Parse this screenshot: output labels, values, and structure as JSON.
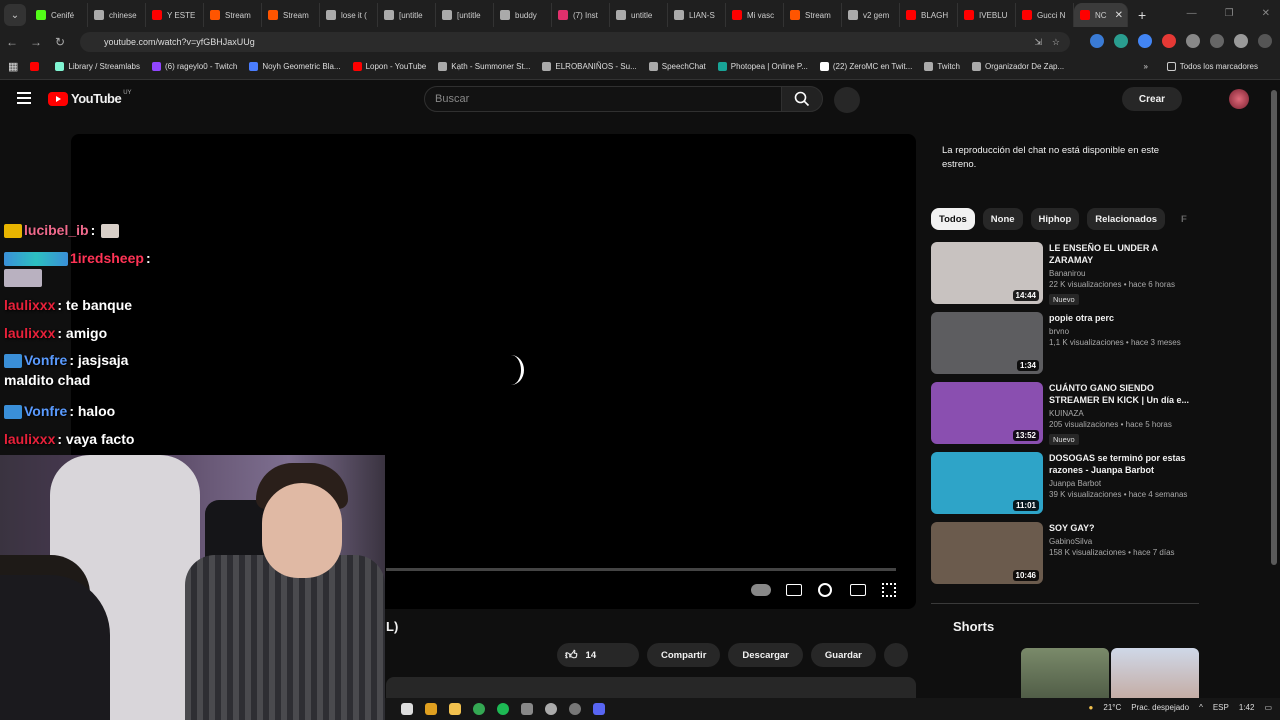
{
  "browser": {
    "tabs": [
      {
        "label": "Cenifé",
        "color": "#53fc18"
      },
      {
        "label": "chinese",
        "color": "#aaaaaa"
      },
      {
        "label": "Y ESTE",
        "color": "#ff0000"
      },
      {
        "label": "Stream",
        "color": "#ff5500"
      },
      {
        "label": "Stream",
        "color": "#ff5500"
      },
      {
        "label": "lose it (",
        "color": "#aaaaaa"
      },
      {
        "label": "[untitle",
        "color": "#aaaaaa"
      },
      {
        "label": "[untitle",
        "color": "#aaaaaa"
      },
      {
        "label": "buddy",
        "color": "#aaaaaa"
      },
      {
        "label": "(7) Inst",
        "color": "#e1306c"
      },
      {
        "label": "untitle",
        "color": "#aaaaaa"
      },
      {
        "label": "LIAN-S",
        "color": "#aaaaaa"
      },
      {
        "label": "Mi vasc",
        "color": "#ff0000"
      },
      {
        "label": "Stream",
        "color": "#ff5500"
      },
      {
        "label": "v2 gem",
        "color": "#aaaaaa"
      },
      {
        "label": "BLAGH",
        "color": "#ff0000"
      },
      {
        "label": "IVEBLU",
        "color": "#ff0000"
      },
      {
        "label": "Gucci N",
        "color": "#ff0000"
      },
      {
        "label": "NC",
        "color": "#ff0000"
      }
    ],
    "url": "youtube.com/watch?v=yfGBHJaxUUg",
    "bookmarks": [
      {
        "label": "",
        "color": "#ff0000"
      },
      {
        "label": "Library / Streamlabs",
        "color": "#80f5d2"
      },
      {
        "label": "(6) rageylo0 - Twitch",
        "color": "#9146ff"
      },
      {
        "label": "Noyh Geometric Bla...",
        "color": "#4a7dff"
      },
      {
        "label": "Lopon - YouTube",
        "color": "#ff0000"
      },
      {
        "label": "Kạth - Summoner St...",
        "color": "#aaaaaa"
      },
      {
        "label": "ELROBANIÑOS - Su...",
        "color": "#aaaaaa"
      },
      {
        "label": "SpeechChat",
        "color": "#aaaaaa"
      },
      {
        "label": "Photopea | Online P...",
        "color": "#18a497"
      },
      {
        "label": "(22) ZeroMC en Twit...",
        "color": "#ffffff"
      },
      {
        "label": "Twitch",
        "color": "#aaaaaa"
      },
      {
        "label": "Organizador De Zap...",
        "color": "#aaaaaa"
      }
    ],
    "all_bookmarks": "Todos los marcadores"
  },
  "youtube": {
    "logo_text": "YouTube",
    "region": "UY",
    "search_placeholder": "Buscar",
    "create_label": "Crear",
    "chat_notice": "La reproducción del chat no está disponible en este estreno.",
    "chips": [
      "Todos",
      "None",
      "Hiphop",
      "Relacionados",
      "F"
    ],
    "recommendations": [
      {
        "title": "LE ENSEÑO EL UNDER A ZARAMAY",
        "channel": "Bananirou",
        "meta": "22 K visualizaciones • hace 6 horas",
        "duration": "14:44",
        "badge": "Nuevo",
        "thumb": "#c8c2c0"
      },
      {
        "title": "popie otra perc",
        "channel": "brvno",
        "meta": "1,1 K visualizaciones • hace 3 meses",
        "duration": "1:34",
        "badge": "",
        "thumb": "#5d5d60"
      },
      {
        "title": "CUÁNTO GANO SIENDO STREAMER EN KICK | Un día e...",
        "channel": "KUINAZA",
        "meta": "205 visualizaciones • hace 5 horas",
        "duration": "13:52",
        "badge": "Nuevo",
        "thumb": "#8a4fb0"
      },
      {
        "title": "DOSOGAS se terminó por estas razones - Juanpa Barbot",
        "channel": "Juanpa Barbot",
        "meta": "39 K visualizaciones • hace 4 semanas",
        "duration": "11:01",
        "badge": "",
        "thumb": "#2ea4c8"
      },
      {
        "title": "SOY GAY?",
        "channel": "GabinoSilva",
        "meta": "158 K visualizaciones • hace 7 días",
        "duration": "10:46",
        "badge": "",
        "thumb": "#6b5b4d"
      }
    ],
    "shorts_heading": "Shorts",
    "video_title_fragment": "L)",
    "likes": "14",
    "share_label": "Compartir",
    "download_label": "Descargar",
    "save_label": "Guardar"
  },
  "overlay_chat": [
    {
      "user": "lucibel_ib",
      "text": ":",
      "color": "#f06a8c"
    },
    {
      "user": "1iredsheep",
      "text": ":",
      "color": "#ff3355"
    },
    {
      "user": "laulixxx",
      "text": ": te banque",
      "color": "#e8213a"
    },
    {
      "user": "laulixxx",
      "text": ": amigo",
      "color": "#e8213a"
    },
    {
      "user": "Vonfre",
      "text": ": jasjsaja",
      "color": "#5a9bff",
      "continuation": "maldito chad"
    },
    {
      "user": "Vonfre",
      "text": ": haloo",
      "color": "#5a9bff"
    },
    {
      "user": "laulixxx",
      "text": ": vaya facto",
      "color": "#e8213a"
    }
  ],
  "taskbar": {
    "temperature": "21°C",
    "weather": "Prac. despejado",
    "lang": "ESP",
    "time": "1:42"
  }
}
